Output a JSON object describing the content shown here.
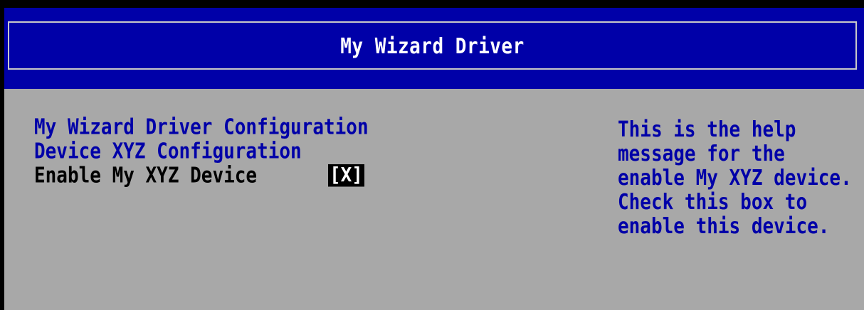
{
  "title": "My Wizard Driver",
  "form": {
    "line1": "My Wizard Driver Configuration",
    "line2": "Device XYZ Configuration",
    "option_label": "Enable My XYZ Device",
    "option_value": "[X]"
  },
  "help": {
    "lines": [
      "This is the help",
      "message for the",
      "enable My XYZ device.",
      "Check this box to",
      "enable this device."
    ]
  },
  "colors": {
    "title_background": "#0000a8",
    "body_background": "#a8a8a8",
    "link_text": "#0000a8",
    "selected_text": "#000000",
    "title_text": "#ffffff"
  }
}
